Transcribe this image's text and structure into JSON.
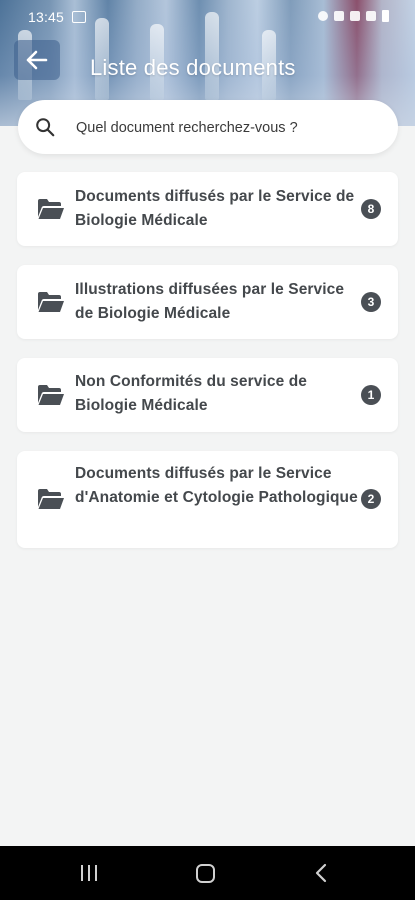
{
  "status_bar": {
    "time": "13:45"
  },
  "header": {
    "title": "Liste des documents"
  },
  "search": {
    "placeholder": "Quel document recherchez-vous ?"
  },
  "documents": [
    {
      "label": "Documents diffusés par le Service de Biologie Médicale",
      "count": "8"
    },
    {
      "label": "Illustrations diffusées par le Service de Biologie Médicale",
      "count": "3"
    },
    {
      "label": "Non Conformités du service de Biologie Médicale",
      "count": "1"
    },
    {
      "label": "Documents diffusés par le Service d'Anatomie et Cytologie Pathologique",
      "count": "2"
    }
  ],
  "colors": {
    "badge": "#4a4f55",
    "text": "#44484c",
    "background": "#f3f4f4"
  }
}
